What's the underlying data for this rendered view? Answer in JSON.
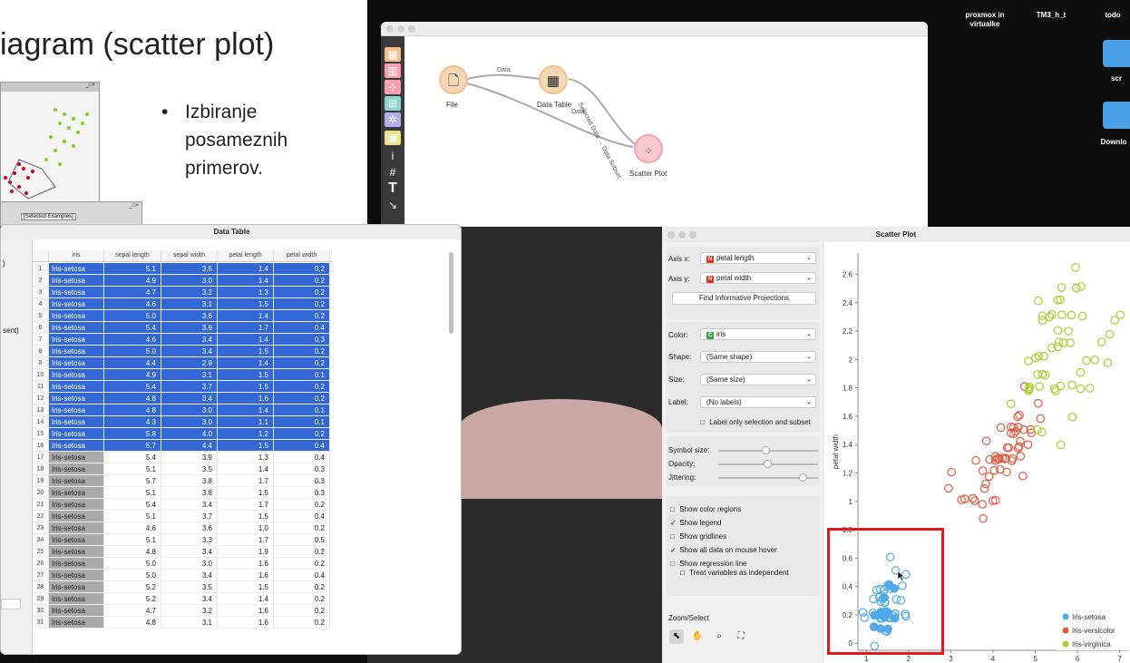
{
  "slide": {
    "title": "iagram (scatter plot)",
    "bullet": "Izbiranje posameznih primerov.",
    "mini_window_tab": "[Selected Examples]"
  },
  "desktop": {
    "icons": [
      {
        "label": "proxmox in virtualke"
      },
      {
        "label": "TM3_h_t"
      },
      {
        "label": "todo"
      },
      {
        "label": "scr"
      },
      {
        "label": "Downlo"
      }
    ]
  },
  "canvas": {
    "nodes": {
      "file": "File",
      "data_table": "Data Table",
      "scatter_plot": "Scatter Plot"
    },
    "links": {
      "file_to_table": "Data",
      "file_to_scatter": "Data",
      "table_to_scatter": "Selected Data → Data Subset"
    },
    "toolbox_icons": [
      "table-icon",
      "chart-icon",
      "tree-icon",
      "network-icon",
      "cluster-icon",
      "image-icon",
      "info-icon",
      "hash-icon",
      "text-icon",
      "arrow-icon"
    ]
  },
  "data_table": {
    "title": "Data Table",
    "columns": [
      "iris",
      "sepal length",
      "sepal width",
      "petal length",
      "petal width"
    ],
    "side_fragments": [
      ")",
      "sent)"
    ],
    "rows": [
      {
        "n": "1",
        "iris": "Iris-setosa",
        "sl": "5.1",
        "sw": "3.5",
        "pl": "1.4",
        "pw": "0.2",
        "sel": true
      },
      {
        "n": "2",
        "iris": "Iris-setosa",
        "sl": "4.9",
        "sw": "3.0",
        "pl": "1.4",
        "pw": "0.2",
        "sel": true
      },
      {
        "n": "3",
        "iris": "Iris-setosa",
        "sl": "4.7",
        "sw": "3.2",
        "pl": "1.3",
        "pw": "0.2",
        "sel": true
      },
      {
        "n": "4",
        "iris": "Iris-setosa",
        "sl": "4.6",
        "sw": "3.1",
        "pl": "1.5",
        "pw": "0.2",
        "sel": true
      },
      {
        "n": "5",
        "iris": "Iris-setosa",
        "sl": "5.0",
        "sw": "3.6",
        "pl": "1.4",
        "pw": "0.2",
        "sel": true
      },
      {
        "n": "6",
        "iris": "Iris-setosa",
        "sl": "5.4",
        "sw": "3.9",
        "pl": "1.7",
        "pw": "0.4",
        "sel": true
      },
      {
        "n": "7",
        "iris": "Iris-setosa",
        "sl": "4.6",
        "sw": "3.4",
        "pl": "1.4",
        "pw": "0.3",
        "sel": true
      },
      {
        "n": "8",
        "iris": "Iris-setosa",
        "sl": "5.0",
        "sw": "3.4",
        "pl": "1.5",
        "pw": "0.2",
        "sel": true
      },
      {
        "n": "9",
        "iris": "Iris-setosa",
        "sl": "4.4",
        "sw": "2.9",
        "pl": "1.4",
        "pw": "0.2",
        "sel": true
      },
      {
        "n": "10",
        "iris": "Iris-setosa",
        "sl": "4.9",
        "sw": "3.1",
        "pl": "1.5",
        "pw": "0.1",
        "sel": true
      },
      {
        "n": "11",
        "iris": "Iris-setosa",
        "sl": "5.4",
        "sw": "3.7",
        "pl": "1.5",
        "pw": "0.2",
        "sel": true
      },
      {
        "n": "12",
        "iris": "Iris-setosa",
        "sl": "4.8",
        "sw": "3.4",
        "pl": "1.6",
        "pw": "0.2",
        "sel": true
      },
      {
        "n": "13",
        "iris": "Iris-setosa",
        "sl": "4.8",
        "sw": "3.0",
        "pl": "1.4",
        "pw": "0.1",
        "sel": true
      },
      {
        "n": "14",
        "iris": "Iris-setosa",
        "sl": "4.3",
        "sw": "3.0",
        "pl": "1.1",
        "pw": "0.1",
        "sel": true
      },
      {
        "n": "15",
        "iris": "Iris-setosa",
        "sl": "5.8",
        "sw": "4.0",
        "pl": "1.2",
        "pw": "0.2",
        "sel": true
      },
      {
        "n": "16",
        "iris": "Iris-setosa",
        "sl": "5.7",
        "sw": "4.4",
        "pl": "1.5",
        "pw": "0.4",
        "sel": true
      },
      {
        "n": "17",
        "iris": "Iris-setosa",
        "sl": "5.4",
        "sw": "3.9",
        "pl": "1.3",
        "pw": "0.4",
        "sel": false
      },
      {
        "n": "18",
        "iris": "Iris-setosa",
        "sl": "5.1",
        "sw": "3.5",
        "pl": "1.4",
        "pw": "0.3",
        "sel": false
      },
      {
        "n": "19",
        "iris": "Iris-setosa",
        "sl": "5.7",
        "sw": "3.8",
        "pl": "1.7",
        "pw": "0.3",
        "sel": false
      },
      {
        "n": "20",
        "iris": "Iris-setosa",
        "sl": "5.1",
        "sw": "3.8",
        "pl": "1.5",
        "pw": "0.3",
        "sel": false
      },
      {
        "n": "21",
        "iris": "Iris-setosa",
        "sl": "5.4",
        "sw": "3.4",
        "pl": "1.7",
        "pw": "0.2",
        "sel": false
      },
      {
        "n": "22",
        "iris": "Iris-setosa",
        "sl": "5.1",
        "sw": "3.7",
        "pl": "1.5",
        "pw": "0.4",
        "sel": false
      },
      {
        "n": "23",
        "iris": "Iris-setosa",
        "sl": "4.6",
        "sw": "3.6",
        "pl": "1.0",
        "pw": "0.2",
        "sel": false
      },
      {
        "n": "24",
        "iris": "Iris-setosa",
        "sl": "5.1",
        "sw": "3.3",
        "pl": "1.7",
        "pw": "0.5",
        "sel": false
      },
      {
        "n": "25",
        "iris": "Iris-setosa",
        "sl": "4.8",
        "sw": "3.4",
        "pl": "1.9",
        "pw": "0.2",
        "sel": false
      },
      {
        "n": "26",
        "iris": "Iris-setosa",
        "sl": "5.0",
        "sw": "3.0",
        "pl": "1.6",
        "pw": "0.2",
        "sel": false
      },
      {
        "n": "27",
        "iris": "Iris-setosa",
        "sl": "5.0",
        "sw": "3.4",
        "pl": "1.6",
        "pw": "0.4",
        "sel": false
      },
      {
        "n": "28",
        "iris": "Iris-setosa",
        "sl": "5.2",
        "sw": "3.5",
        "pl": "1.5",
        "pw": "0.2",
        "sel": false
      },
      {
        "n": "29",
        "iris": "Iris-setosa",
        "sl": "5.2",
        "sw": "3.4",
        "pl": "1.4",
        "pw": "0.2",
        "sel": false
      },
      {
        "n": "30",
        "iris": "Iris-setosa",
        "sl": "4.7",
        "sw": "3.2",
        "pl": "1.6",
        "pw": "0.2",
        "sel": false
      },
      {
        "n": "31",
        "iris": "Iris-setosa",
        "sl": "4.8",
        "sw": "3.1",
        "pl": "1.6",
        "pw": "0.2",
        "sel": false
      }
    ],
    "colors": {
      "selected": "#3367d6",
      "unselected_cell": "#a9a9a9"
    }
  },
  "scatter": {
    "title": "Scatter Plot",
    "axis_x_label": "Axis x:",
    "axis_x_value": "petal length",
    "axis_y_label": "Axis y:",
    "axis_y_value": "petal width",
    "find_button": "Find Informative Projections",
    "color_label": "Color:",
    "color_value": "iris",
    "shape_label": "Shape:",
    "shape_value": "(Same shape)",
    "size_label": "Size:",
    "size_value": "(Same size)",
    "label_label": "Label:",
    "label_value": "(No labels)",
    "label_only_selection": "Label only selection and subset",
    "symbol_size_label": "Symbol size:",
    "opacity_label": "Opacity:",
    "jittering_label": "Jittering:",
    "checkboxes": [
      {
        "label": "Show color regions",
        "checked": false
      },
      {
        "label": "Show legend",
        "checked": true
      },
      {
        "label": "Show gridlines",
        "checked": false
      },
      {
        "label": "Show all data on mouse hover",
        "checked": true
      },
      {
        "label": "Show regression line",
        "checked": false
      }
    ],
    "treat_independent": "Treat variables as independent",
    "zoom_select_label": "Zoom/Select"
  },
  "chart_data": {
    "type": "scatter",
    "xlabel": "",
    "ylabel": "petal width",
    "xlim": [
      0.8,
      7.2
    ],
    "ylim": [
      -0.05,
      2.75
    ],
    "xticks": [
      1,
      2,
      3,
      4,
      5,
      6,
      7
    ],
    "yticks": [
      0,
      0.2,
      0.4,
      0.6,
      0.8,
      1,
      1.2,
      1.4,
      1.6,
      1.8,
      2,
      2.2,
      2.4,
      2.6
    ],
    "legend_position": "bottom-right",
    "series": [
      {
        "name": "Iris-setosa",
        "color": "#4fa8e8",
        "points": [
          [
            1.4,
            0.2
          ],
          [
            1.4,
            0.2
          ],
          [
            1.3,
            0.2
          ],
          [
            1.5,
            0.2
          ],
          [
            1.4,
            0.2
          ],
          [
            1.7,
            0.4
          ],
          [
            1.4,
            0.3
          ],
          [
            1.5,
            0.2
          ],
          [
            1.4,
            0.2
          ],
          [
            1.5,
            0.1
          ],
          [
            1.5,
            0.2
          ],
          [
            1.6,
            0.2
          ],
          [
            1.4,
            0.1
          ],
          [
            1.1,
            0.1
          ],
          [
            1.2,
            0.2
          ],
          [
            1.5,
            0.4
          ],
          [
            1.3,
            0.4
          ],
          [
            1.4,
            0.3
          ],
          [
            1.7,
            0.3
          ],
          [
            1.5,
            0.3
          ],
          [
            1.7,
            0.2
          ],
          [
            1.5,
            0.4
          ],
          [
            1.0,
            0.2
          ],
          [
            1.7,
            0.5
          ],
          [
            1.9,
            0.2
          ],
          [
            1.6,
            0.2
          ],
          [
            1.6,
            0.4
          ],
          [
            1.5,
            0.2
          ],
          [
            1.4,
            0.2
          ],
          [
            1.6,
            0.2
          ],
          [
            1.6,
            0.2
          ],
          [
            1.5,
            0.4
          ],
          [
            1.5,
            0.1
          ],
          [
            1.4,
            0.2
          ],
          [
            1.2,
            0.2
          ],
          [
            1.3,
            0.2
          ],
          [
            1.5,
            0.1
          ],
          [
            1.3,
            0.2
          ],
          [
            1.5,
            0.2
          ],
          [
            1.3,
            0.3
          ],
          [
            1.3,
            0.3
          ],
          [
            1.6,
            0.6
          ],
          [
            1.9,
            0.4
          ],
          [
            1.4,
            0.3
          ],
          [
            1.6,
            0.2
          ],
          [
            1.4,
            0.2
          ],
          [
            1.5,
            0.2
          ],
          [
            1.4,
            0.2
          ],
          [
            1.2,
            0.0
          ],
          [
            1.8,
            0.3
          ],
          [
            2.0,
            0.5
          ],
          [
            1.1,
            0.3
          ],
          [
            1.0,
            0.2
          ],
          [
            1.9,
            0.2
          ],
          [
            1.3,
            0.4
          ],
          [
            1.6,
            0.4
          ]
        ],
        "selected_count": 16
      },
      {
        "name": "Iris-versicolor",
        "color": "#e2583e",
        "points": [
          [
            4.7,
            1.4
          ],
          [
            4.5,
            1.5
          ],
          [
            4.9,
            1.5
          ],
          [
            4.0,
            1.3
          ],
          [
            4.6,
            1.5
          ],
          [
            4.5,
            1.3
          ],
          [
            4.7,
            1.6
          ],
          [
            3.3,
            1.0
          ],
          [
            4.6,
            1.3
          ],
          [
            3.9,
            1.4
          ],
          [
            3.5,
            1.0
          ],
          [
            4.2,
            1.5
          ],
          [
            4.0,
            1.0
          ],
          [
            4.7,
            1.4
          ],
          [
            3.6,
            1.3
          ],
          [
            4.4,
            1.4
          ],
          [
            4.5,
            1.5
          ],
          [
            4.1,
            1.0
          ],
          [
            4.5,
            1.5
          ],
          [
            3.9,
            1.1
          ],
          [
            4.8,
            1.8
          ],
          [
            4.0,
            1.3
          ],
          [
            4.9,
            1.5
          ],
          [
            4.7,
            1.2
          ],
          [
            4.3,
            1.3
          ],
          [
            4.4,
            1.4
          ],
          [
            4.8,
            1.4
          ],
          [
            5.0,
            1.7
          ],
          [
            4.5,
            1.5
          ],
          [
            3.5,
            1.0
          ],
          [
            3.8,
            1.1
          ],
          [
            3.7,
            1.0
          ],
          [
            3.9,
            1.2
          ],
          [
            5.1,
            1.6
          ],
          [
            4.5,
            1.5
          ],
          [
            4.5,
            1.6
          ],
          [
            4.7,
            1.5
          ],
          [
            4.4,
            1.3
          ],
          [
            4.1,
            1.3
          ],
          [
            4.0,
            1.3
          ],
          [
            4.4,
            1.2
          ],
          [
            4.6,
            1.4
          ],
          [
            4.0,
            1.2
          ],
          [
            3.3,
            1.0
          ],
          [
            4.2,
            1.3
          ],
          [
            4.2,
            1.2
          ],
          [
            4.2,
            1.3
          ],
          [
            4.3,
            1.3
          ],
          [
            3.0,
            1.1
          ],
          [
            4.1,
            1.3
          ],
          [
            3.8,
            0.9
          ],
          [
            3.0,
            1.2
          ],
          [
            3.7,
            1.2
          ]
        ]
      },
      {
        "name": "Iris-virginica",
        "color": "#a6cf2e",
        "points": [
          [
            6.0,
            2.5
          ],
          [
            5.1,
            1.9
          ],
          [
            5.9,
            2.1
          ],
          [
            5.6,
            1.8
          ],
          [
            5.8,
            2.2
          ],
          [
            6.6,
            2.1
          ],
          [
            4.5,
            1.7
          ],
          [
            6.3,
            1.8
          ],
          [
            5.8,
            1.8
          ],
          [
            6.1,
            2.5
          ],
          [
            5.1,
            2.0
          ],
          [
            5.3,
            1.9
          ],
          [
            5.5,
            2.1
          ],
          [
            5.0,
            2.0
          ],
          [
            5.1,
            2.4
          ],
          [
            5.3,
            2.3
          ],
          [
            5.5,
            1.8
          ],
          [
            6.7,
            2.2
          ],
          [
            6.9,
            2.3
          ],
          [
            5.0,
            1.5
          ],
          [
            5.7,
            2.3
          ],
          [
            4.9,
            2.0
          ],
          [
            6.7,
            2.0
          ],
          [
            4.9,
            1.8
          ],
          [
            5.7,
            2.1
          ],
          [
            6.0,
            1.8
          ],
          [
            4.8,
            1.8
          ],
          [
            4.9,
            1.8
          ],
          [
            5.6,
            2.1
          ],
          [
            5.8,
            1.6
          ],
          [
            6.1,
            1.9
          ],
          [
            6.4,
            2.0
          ],
          [
            5.6,
            2.2
          ],
          [
            5.1,
            1.5
          ],
          [
            5.6,
            1.4
          ],
          [
            6.1,
            2.3
          ],
          [
            5.6,
            2.4
          ],
          [
            5.5,
            1.8
          ],
          [
            4.8,
            1.8
          ],
          [
            5.4,
            2.1
          ],
          [
            5.6,
            2.4
          ],
          [
            5.1,
            2.3
          ],
          [
            5.9,
            2.3
          ],
          [
            5.7,
            2.5
          ],
          [
            5.2,
            2.3
          ],
          [
            5.0,
            1.9
          ],
          [
            5.2,
            2.0
          ],
          [
            5.4,
            2.3
          ],
          [
            5.1,
            1.8
          ],
          [
            6.0,
            2.65
          ],
          [
            7.0,
            2.3
          ],
          [
            6.2,
            2.0
          ]
        ]
      }
    ]
  }
}
